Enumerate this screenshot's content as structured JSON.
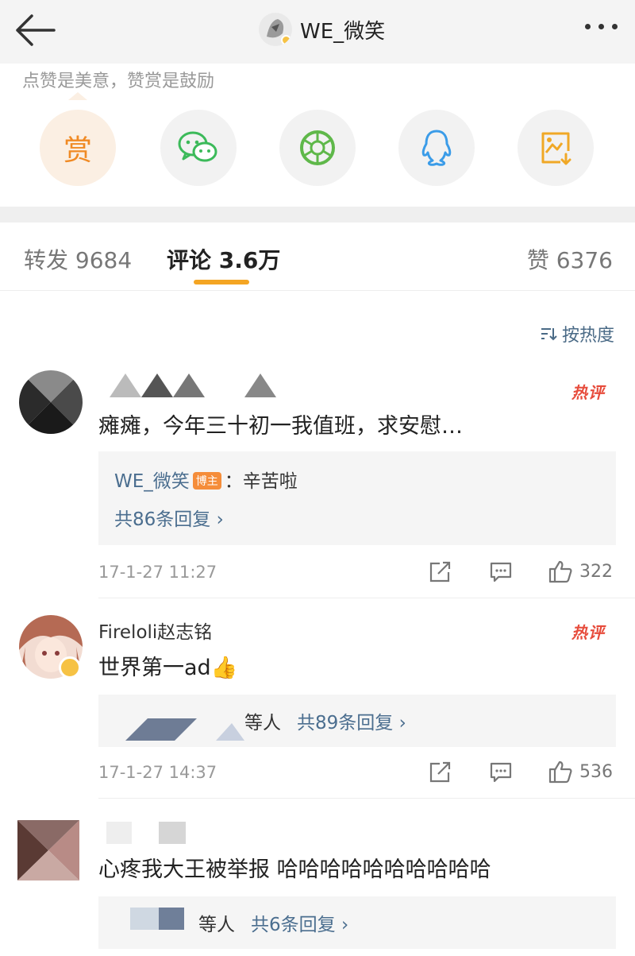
{
  "nav": {
    "title": "WE_微笑",
    "back_icon": "arrow-left-icon",
    "more_icon": "more-dots-icon"
  },
  "share_panel": {
    "slogan": "点赞是美意，赞赏是鼓励",
    "buttons": [
      {
        "name": "reward",
        "label": "赏",
        "icon": "reward-icon",
        "color": "#f08a24"
      },
      {
        "name": "wechat",
        "icon": "wechat-icon",
        "color": "#3cba5a"
      },
      {
        "name": "moments",
        "icon": "moments-icon",
        "color": "#5fb84a"
      },
      {
        "name": "qq",
        "icon": "qq-icon",
        "color": "#3b9ce8"
      },
      {
        "name": "save-image",
        "icon": "save-image-icon",
        "color": "#f0a826"
      }
    ]
  },
  "tabs": [
    {
      "label": "转发 9684"
    },
    {
      "label": "评论 3.6万",
      "active": true
    },
    {
      "label": "赞 6376"
    }
  ],
  "sort": {
    "label": "按热度",
    "icon": "sort-icon"
  },
  "comments": [
    {
      "hot_badge": "热评",
      "text": "瘫瘫，今年三十初一我值班，求安慰…",
      "reply": {
        "author": "WE_微笑",
        "badge": "博主",
        "text": "：辛苦啦",
        "count": "共86条回复 ›"
      },
      "time": "17-1-27 11:27",
      "likes": "322"
    },
    {
      "name": "Fireloli赵志铭",
      "hot_badge": "热评",
      "text": "世界第一ad👍",
      "reply": {
        "suffix": "等人",
        "count": "共89条回复 ›"
      },
      "time": "17-1-27 14:37",
      "likes": "536"
    },
    {
      "text": "心疼我大王被举报 哈哈哈哈哈哈哈哈哈哈",
      "reply": {
        "suffix": "等人",
        "count": "共6条回复 ›"
      }
    }
  ]
}
